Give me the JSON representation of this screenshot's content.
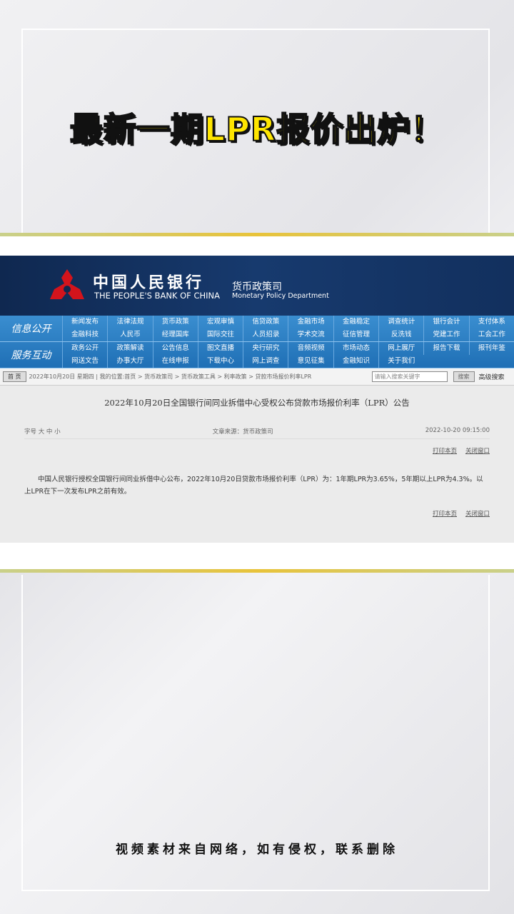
{
  "headline": "最新一期LPR报价出炉！",
  "site": {
    "name_cn": "中国人民银行",
    "name_en": "THE PEOPLE'S BANK OF CHINA",
    "dept_cn": "货币政策司",
    "dept_en": "Monetary Policy Department"
  },
  "nav": {
    "sections": [
      {
        "label": "信息公开",
        "items": [
          "新闻发布",
          "法律法规",
          "货币政策",
          "宏观审慎",
          "信贷政策",
          "金融市场",
          "金融稳定",
          "调查统计",
          "银行会计",
          "支付体系",
          "金融科技",
          "人民币",
          "经理国库",
          "国际交往",
          "人员招录",
          "学术交流",
          "征信管理",
          "反洗钱",
          "党建工作",
          "工会工作"
        ]
      },
      {
        "label": "服务互动",
        "items": [
          "政务公开",
          "政策解读",
          "公告信息",
          "图文直播",
          "央行研究",
          "音频视频",
          "市场动态",
          "网上展厅",
          "报告下载",
          "报刊年鉴",
          "网送文告",
          "办事大厅",
          "在线申报",
          "下载中心",
          "网上调查",
          "意见征集",
          "金融知识",
          "关于我们"
        ]
      }
    ]
  },
  "crumb": {
    "home": "首 页",
    "text": "2022年10月20日 星期四 | 我的位置:首页 > 货币政策司 > 货币政策工具 > 利率政策 > 贷款市场报价利率LPR",
    "search_placeholder": "请输入搜索关键字",
    "search": "搜索",
    "advanced": "高级搜索"
  },
  "article": {
    "title": "2022年10月20日全国银行间同业拆借中心受权公布贷款市场报价利率（LPR）公告",
    "font_size": "字号 大 中 小",
    "source": "文章来源：货币政策司",
    "date": "2022-10-20 09:15:00",
    "print": "打印本页",
    "close": "关闭窗口",
    "body": "中国人民银行授权全国银行间同业拆借中心公布，2022年10月20日贷款市场报价利率（LPR）为：1年期LPR为3.65%，5年期以上LPR为4.3%。以上LPR在下一次发布LPR之前有效。"
  },
  "footer": "视频素材来自网络，如有侵权，联系删除"
}
